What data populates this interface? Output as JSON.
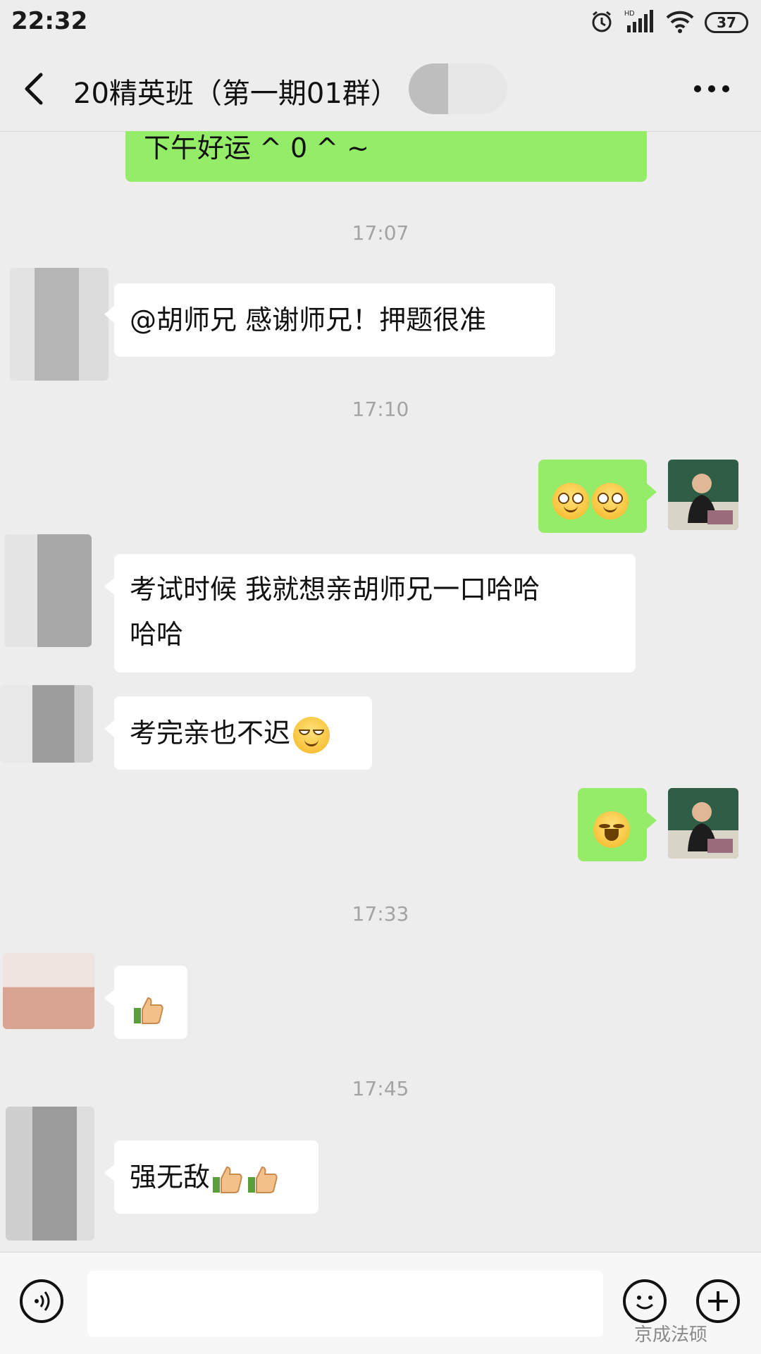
{
  "status_bar": {
    "time": "22:32",
    "battery": "37"
  },
  "header": {
    "title": "20精英班（第一期01群）"
  },
  "messages": [
    {
      "side": "out",
      "text": "下午好运 ^ 0 ^ ~"
    },
    {
      "timestamp": "17:07"
    },
    {
      "side": "in",
      "text": "@胡师兄  感谢师兄！押题很准"
    },
    {
      "timestamp": "17:10"
    },
    {
      "side": "out",
      "emoji": "peek-eyes-emoji x2"
    },
    {
      "side": "in",
      "text_line1": "考试时候  我就想亲胡师兄一口哈哈",
      "text_line2": "哈哈"
    },
    {
      "side": "in",
      "text": "考完亲也不迟",
      "emoji": "smirk-emoji"
    },
    {
      "side": "out",
      "emoji": "laughing-tears-emoji"
    },
    {
      "timestamp": "17:33"
    },
    {
      "side": "in",
      "emoji": "thumbs-up-emoji"
    },
    {
      "timestamp": "17:45"
    },
    {
      "side": "in",
      "text": "强无敌",
      "emoji": "thumbs-up-emoji x2"
    }
  ],
  "input_bar": {
    "watermark": "京成法硕"
  },
  "colors": {
    "outgoing_bubble": "#95ec69",
    "incoming_bubble": "#ffffff",
    "background": "#ededed"
  }
}
